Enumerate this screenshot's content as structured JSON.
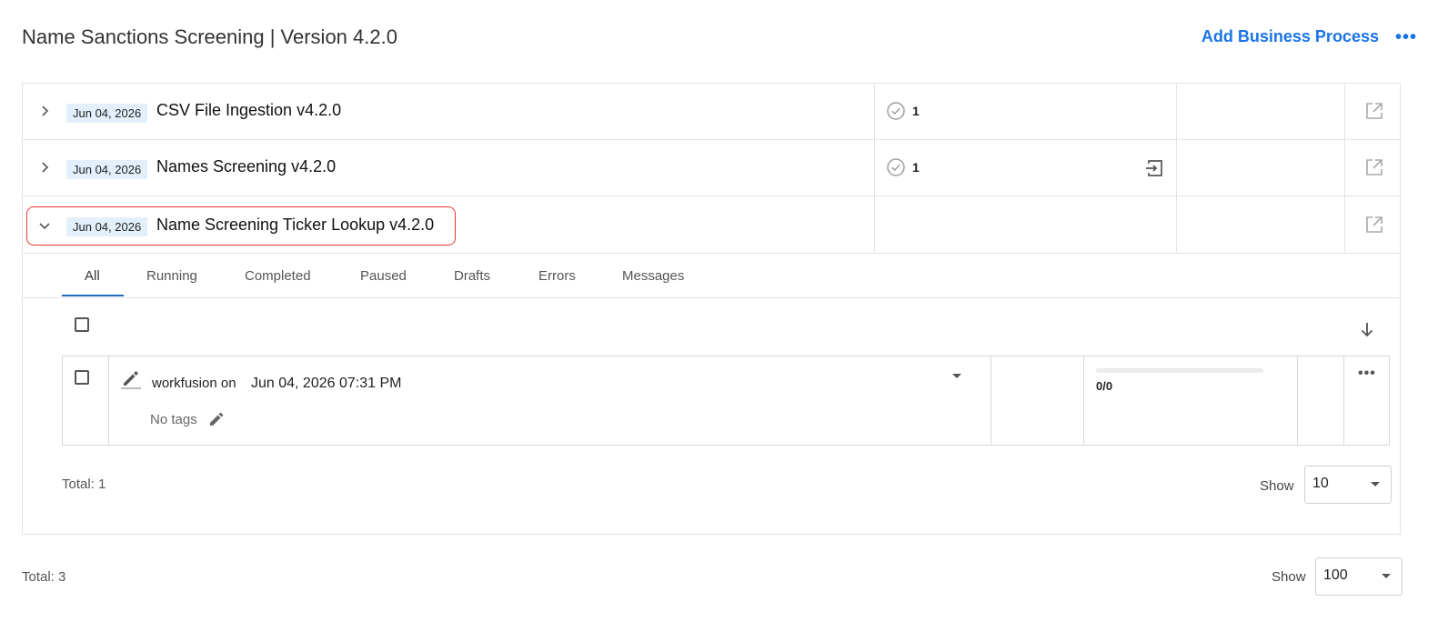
{
  "header": {
    "title": "Name Sanctions Screening | Version 4.2.0",
    "add_label": "Add Business Process",
    "more_icon": "more-horizontal-icon",
    "accent_color": "#1a73e8"
  },
  "processes": [
    {
      "date": "Jun 04, 2026",
      "name": "CSV File Ingestion v4.2.0",
      "completed_count": "1",
      "expanded": false
    },
    {
      "date": "Jun 04, 2026",
      "name": "Names Screening v4.2.0",
      "completed_count": "1",
      "expanded": false
    },
    {
      "date": "Jun 04, 2026",
      "name": "Name Screening Ticker Lookup v4.2.0",
      "expanded": true
    }
  ],
  "tabs": [
    "All",
    "Running",
    "Completed",
    "Paused",
    "Drafts",
    "Errors",
    "Messages"
  ],
  "active_tab": "All",
  "runs": [
    {
      "author": "workfusion on",
      "date": "Jun 04, 2026 07:31 PM",
      "tags": "No tags",
      "progress_text": "0/0",
      "progress": 0
    }
  ],
  "inner_footer": {
    "total": "Total: 1",
    "show_label": "Show",
    "page_size": "10"
  },
  "outer_footer": {
    "total": "Total: 3",
    "show_label": "Show",
    "page_size": "100"
  }
}
